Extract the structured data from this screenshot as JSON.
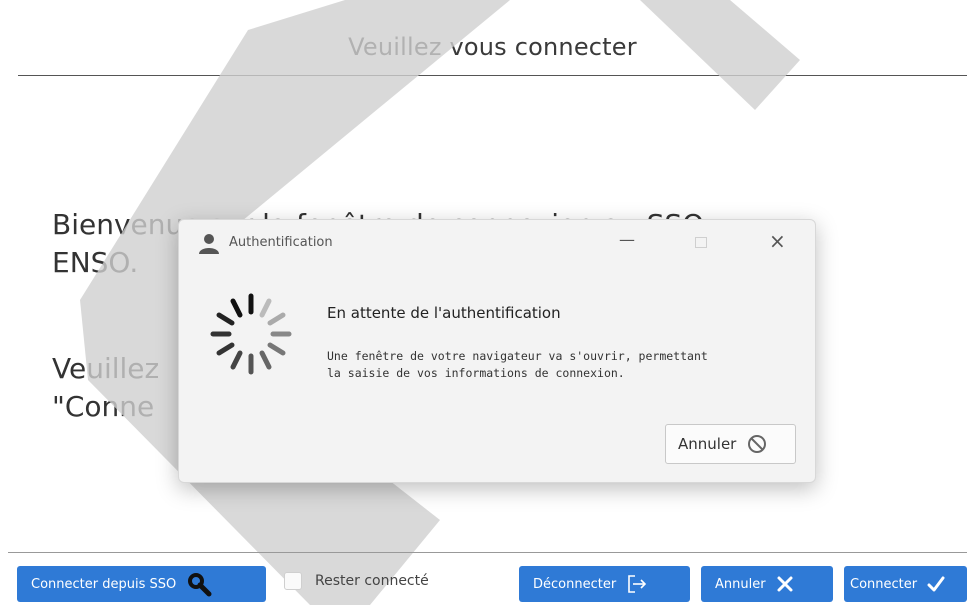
{
  "header": {
    "title": "Veuillez vous connecter"
  },
  "welcome": {
    "line1": "Bienvenue sur la fenêtre de connexion au SSO",
    "line2": "ENSO.",
    "line3": "Veuillez",
    "line4": "\"Conne"
  },
  "footer": {
    "sso_button": "Connecter depuis SSO",
    "remember_label": "Rester connecté",
    "remember_checked": false,
    "disconnect_button": "Déconnecter",
    "cancel_button": "Annuler",
    "connect_button": "Connecter"
  },
  "dialog": {
    "title": "Authentification",
    "heading": "En attente de l'authentification",
    "body_line1": "Une fenêtre de votre navigateur va s'ouvrir, permettant",
    "body_line2": "la saisie de vos informations de connexion.",
    "cancel_button": "Annuler"
  },
  "colors": {
    "accent": "#2f7ad6",
    "watermark": "#d0d0d0"
  },
  "icons": [
    "search-icon",
    "logout-icon",
    "close-x-icon",
    "check-icon",
    "user-icon",
    "minimize-icon",
    "maximize-icon",
    "close-icon",
    "spinner-icon",
    "cancel-circle-icon"
  ]
}
